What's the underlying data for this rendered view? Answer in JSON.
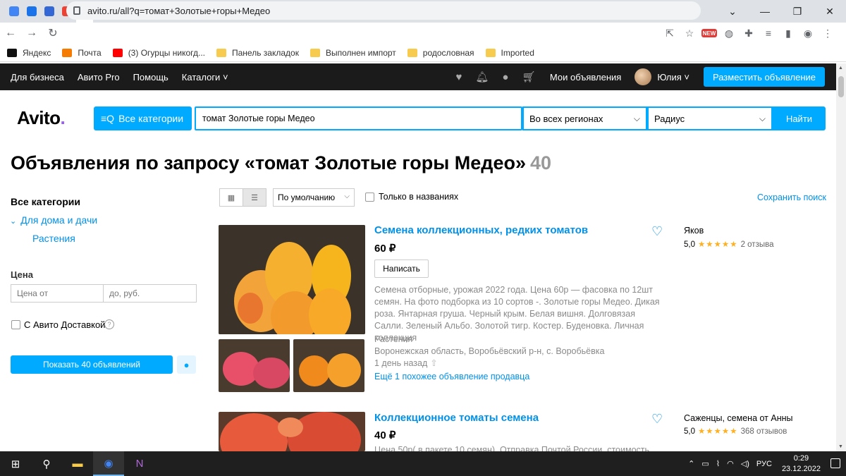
{
  "browser": {
    "tabs": [
      {
        "name": "chrome-tab",
        "color": "#4285f4"
      },
      {
        "name": "tab-2",
        "color": "#1a73e8"
      },
      {
        "name": "mail-tab",
        "color": "#3367d6"
      },
      {
        "name": "tab-4",
        "color": "#ea4335"
      },
      {
        "name": "avito-tab",
        "color": "#965eeb"
      },
      {
        "name": "tab-6",
        "color": "#888888"
      },
      {
        "name": "youtube-tab",
        "color": "#ff0000"
      },
      {
        "name": "tab-8",
        "color": "#222222"
      },
      {
        "name": "tab-9",
        "color": "#2e7d32"
      },
      {
        "name": "tab-10",
        "color": "#222222"
      },
      {
        "name": "tab-11",
        "color": "#388e3c"
      },
      {
        "name": "tab-12",
        "color": "#555555"
      },
      {
        "name": "drive-tab",
        "color": "#fbbc04"
      },
      {
        "name": "tab-14",
        "color": "#1e88e5"
      },
      {
        "name": "tab-15",
        "color": "#43a047"
      },
      {
        "name": "tab-16",
        "color": "#7cb342"
      },
      {
        "name": "tab-17",
        "color": "#d4a017"
      },
      {
        "name": "tab-18",
        "color": "#e53935"
      },
      {
        "name": "tab-19",
        "color": "#222222"
      },
      {
        "name": "tab-20",
        "color": "#f9a825"
      },
      {
        "name": "tab-21",
        "color": "#c62828"
      },
      {
        "name": "tab-22",
        "color": "#111111"
      },
      {
        "name": "tab-23",
        "color": "#424242"
      },
      {
        "name": "pinterest-tab",
        "color": "#e60023"
      },
      {
        "name": "tab-25",
        "color": "#e53935"
      },
      {
        "name": "tab-26",
        "color": "#43a047"
      },
      {
        "name": "tab-27",
        "color": "#f9a825"
      },
      {
        "name": "tab-28",
        "color": "#c0ca33"
      },
      {
        "name": "tab-29",
        "color": "#388e3c"
      },
      {
        "name": "tab-30",
        "color": "#e91e63"
      },
      {
        "name": "tab-31",
        "color": "#2e7d32"
      },
      {
        "name": "tab-32",
        "color": "#8bc34a"
      },
      {
        "name": "tab-33",
        "color": "#37474f"
      },
      {
        "name": "tab-34",
        "color": "#546e7a"
      },
      {
        "name": "tab-35",
        "color": "#1e88e5"
      },
      {
        "name": "vk-tab",
        "color": "#4a76a8"
      },
      {
        "name": "ok-tab",
        "color": "#f7931e"
      }
    ],
    "new_tab_label": "+",
    "url": "avito.ru/all?q=томат+Золотые+горы+Медео",
    "ext_badge": "NEW",
    "bookmarks": [
      {
        "label": "Яндекс",
        "type": "site"
      },
      {
        "label": "Почта",
        "type": "mail"
      },
      {
        "label": "(3) Огурцы никогд...",
        "type": "youtube"
      },
      {
        "label": "Панель закладок",
        "type": "folder"
      },
      {
        "label": "Выполнен импорт",
        "type": "folder"
      },
      {
        "label": "родословная",
        "type": "folder"
      },
      {
        "label": "Imported",
        "type": "folder"
      }
    ]
  },
  "header": {
    "links": [
      "Для бизнеса",
      "Авито Pro",
      "Помощь",
      "Каталоги"
    ],
    "my_ads": "Мои объявления",
    "user": "Юлия",
    "post_button": "Разместить объявление"
  },
  "search": {
    "logo": "Avito",
    "categories_button": "Все категории",
    "query": "томат Золотые горы Медео",
    "region": "Во всех регионах",
    "radius": "Радиус",
    "find_button": "Найти"
  },
  "page": {
    "title": "Объявления по запросу «томат Золотые горы Медео»",
    "count": "40"
  },
  "sidebar": {
    "heading": "Все категории",
    "category": "Для дома и дачи",
    "subcategory": "Растения",
    "price_label": "Цена",
    "price_from_placeholder": "Цена от",
    "price_to_placeholder": "до, руб.",
    "delivery_label": "С Авито Доставкой",
    "show_button": "Показать 40 объявлений"
  },
  "toolbar": {
    "sort": "По умолчанию",
    "titles_only": "Только в названиях",
    "save_search": "Сохранить поиск"
  },
  "listings": [
    {
      "title": "Семена коллекционных, редких томатов",
      "price": "60 ₽",
      "write_button": "Написать",
      "description": "Семена отборные, урожая 2022 года. Цена 60р — фасовка по 12шт семян. На фото подборка из 10 сортов -. Золотые горы Медео. Дикая роза. Янтарная груша. Черный крым. Белая вишня. Долговязая Салли. Зеленый Альбо. Золотой тигр. Костер. Буденовка. Личная коллекция",
      "category": "Растения",
      "location": "Воронежская область, Воробьёвский р-н, с. Воробьёвка",
      "time": "1 день назад",
      "similar": "Ещё 1 похожее объявление продавца",
      "seller": "Яков",
      "rating": "5,0",
      "stars": 5,
      "reviews": "2 отзыва"
    },
    {
      "title": "Коллекционное томаты семена",
      "price": "40 ₽",
      "description": "Цена 50р( в пакете 10 семян). Отправка Почтой России, стоимость",
      "seller": "Саженцы, семена от Анны",
      "rating": "5,0",
      "stars": 5,
      "reviews": "368 отзывов"
    }
  ],
  "taskbar": {
    "lang": "РУС",
    "time": "0:29",
    "date": "23.12.2022"
  }
}
